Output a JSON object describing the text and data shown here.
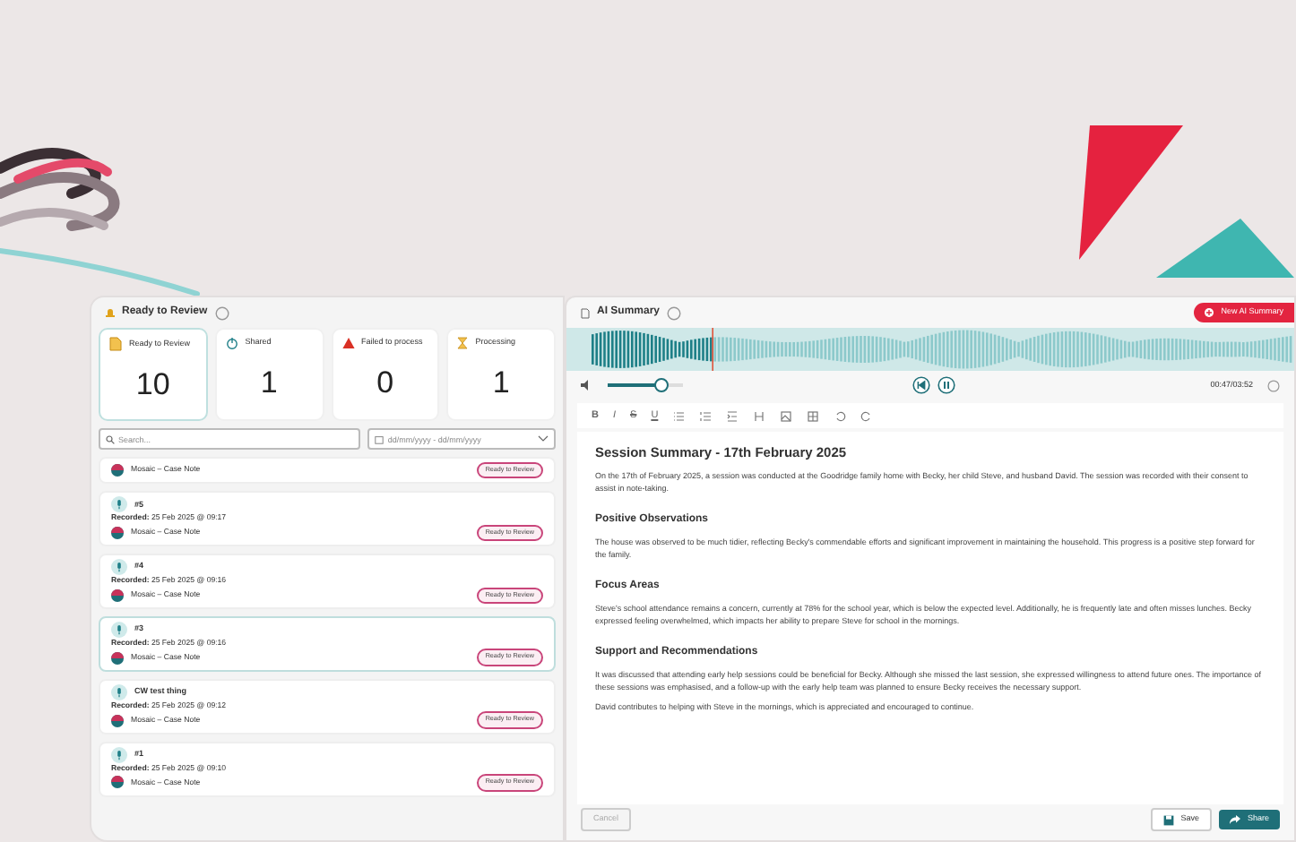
{
  "review_panel": {
    "title": "Ready to Review",
    "stats": [
      {
        "kind": "ready",
        "label": "Ready to Review",
        "value": "10",
        "selected": true
      },
      {
        "kind": "shared",
        "label": "Shared",
        "value": "1",
        "selected": false
      },
      {
        "kind": "failed",
        "label": "Failed to process",
        "value": "0",
        "selected": false
      },
      {
        "kind": "processing",
        "label": "Processing",
        "value": "1",
        "selected": false
      }
    ],
    "search": {
      "placeholder": "Search..."
    },
    "date_filter": {
      "placeholder": "dd/mm/yyyy - dd/mm/yyyy"
    },
    "recordings": [
      {
        "source": "Mosaic – Case Note",
        "status": "Ready to Review",
        "selected": false
      },
      {
        "title": "#5",
        "recorded": "**Recorded:** 25 Feb 2025 @ 09:17",
        "source": "Mosaic – Case Note",
        "status": "Ready to Review",
        "selected": false
      },
      {
        "title": "#4",
        "recorded": "**Recorded:** 25 Feb 2025 @ 09:16",
        "source": "Mosaic – Case Note",
        "status": "Ready to Review",
        "selected": false
      },
      {
        "title": "#3",
        "recorded": "**Recorded:** 25 Feb 2025 @ 09:16",
        "source": "Mosaic – Case Note",
        "status": "Ready to Review",
        "selected": true
      },
      {
        "title": "CW test thing",
        "recorded": "**Recorded:** 25 Feb 2025 @ 09:12",
        "source": "Mosaic – Case Note",
        "status": "Ready to Review",
        "selected": false
      },
      {
        "title": "#1",
        "recorded": "**Recorded:** 25 Feb 2025 @ 09:10",
        "source": "Mosaic – Case Note",
        "status": "Ready to Review",
        "selected": false
      }
    ]
  },
  "summary_panel": {
    "title": "AI Summary",
    "new_button": "New AI Summary",
    "player": {
      "progress": {
        "level": 0.2
      },
      "volume": {
        "level": 0.72
      },
      "time": "00:47/03:52"
    },
    "format_buttons": [
      "B",
      "I",
      "S",
      "U"
    ],
    "document": {
      "title": "Session Summary - 17th February 2025",
      "sections": [
        {
          "paragraphs": [
            "On the 17th of February 2025, a session was conducted at the Goodridge family home with Becky, her child Steve, and husband David. The session was recorded with their consent to assist in note-taking."
          ]
        },
        {
          "heading": "Positive Observations",
          "paragraphs": [
            "The house was observed to be much tidier, reflecting Becky's commendable efforts and significant improvement in maintaining the household. This progress is a positive step forward for the family."
          ]
        },
        {
          "heading": "Focus Areas",
          "paragraphs": [
            "Steve's school attendance remains a concern, currently at 78% for the school year, which is below the expected level. Additionally, he is frequently late and often misses lunches. Becky expressed feeling overwhelmed, which impacts her ability to prepare Steve for school in the mornings."
          ]
        },
        {
          "heading": "Support and Recommendations",
          "paragraphs": [
            "It was discussed that attending early help sessions could be beneficial for Becky. Although she missed the last session, she expressed willingness to attend future ones. The importance of these sessions was emphasised, and a follow-up with the early help team was planned to ensure Becky receives the necessary support.",
            "David contributes to helping with Steve in the mornings, which is appreciated and encouraged to continue."
          ]
        }
      ]
    },
    "footer": {
      "cancel": {
        "label": "Cancel",
        "disabled": true
      },
      "save": "Save",
      "share": "Share"
    }
  }
}
